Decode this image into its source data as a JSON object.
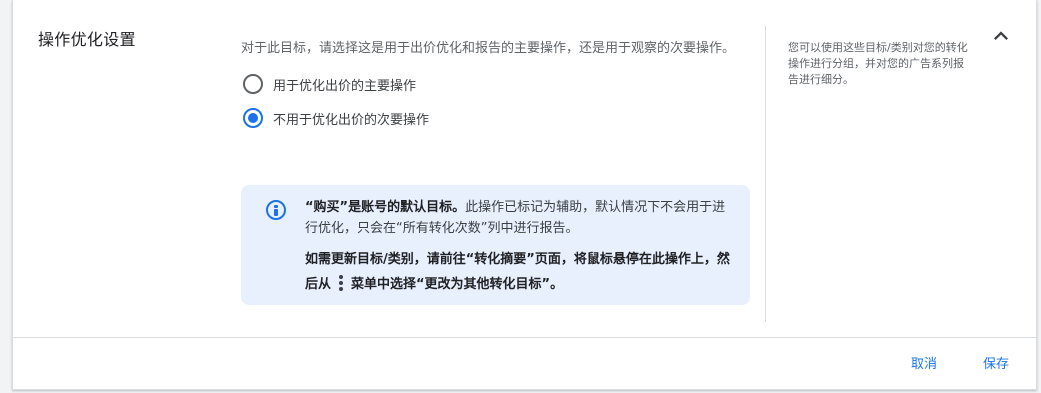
{
  "section": {
    "title": "操作优化设置"
  },
  "description": "对于此目标，请选择这是用于出价优化和报告的主要操作，还是用于观察的次要操作。",
  "radio_options": [
    {
      "label": "用于优化出价的主要操作",
      "checked": false
    },
    {
      "label": "不用于优化出价的次要操作",
      "checked": true
    }
  ],
  "info": {
    "bold_lead": "“购买”是账号的默认目标。",
    "text": "此操作已标记为辅助，默认情况下不会用于进行优化，只会在“所有转化次数”列中进行报告。",
    "p2_before": "如需更新目标/类别，请前往“转化摘要”页面，将鼠标悬停在此操作上，然后从",
    "p2_after": "菜单中选择“更改为其他转化目标”。"
  },
  "side_note": "您可以使用这些目标/类别对您的转化操作进行分组，并对您的广告系列报告进行细分。",
  "footer": {
    "cancel_label": "取消",
    "save_label": "保存"
  },
  "colors": {
    "accent": "#1a73e8",
    "info_bg": "#e8f0fe"
  },
  "icons": {
    "collapse": "chevron-up-icon",
    "info": "info-icon",
    "menu": "more-vert-icon"
  }
}
